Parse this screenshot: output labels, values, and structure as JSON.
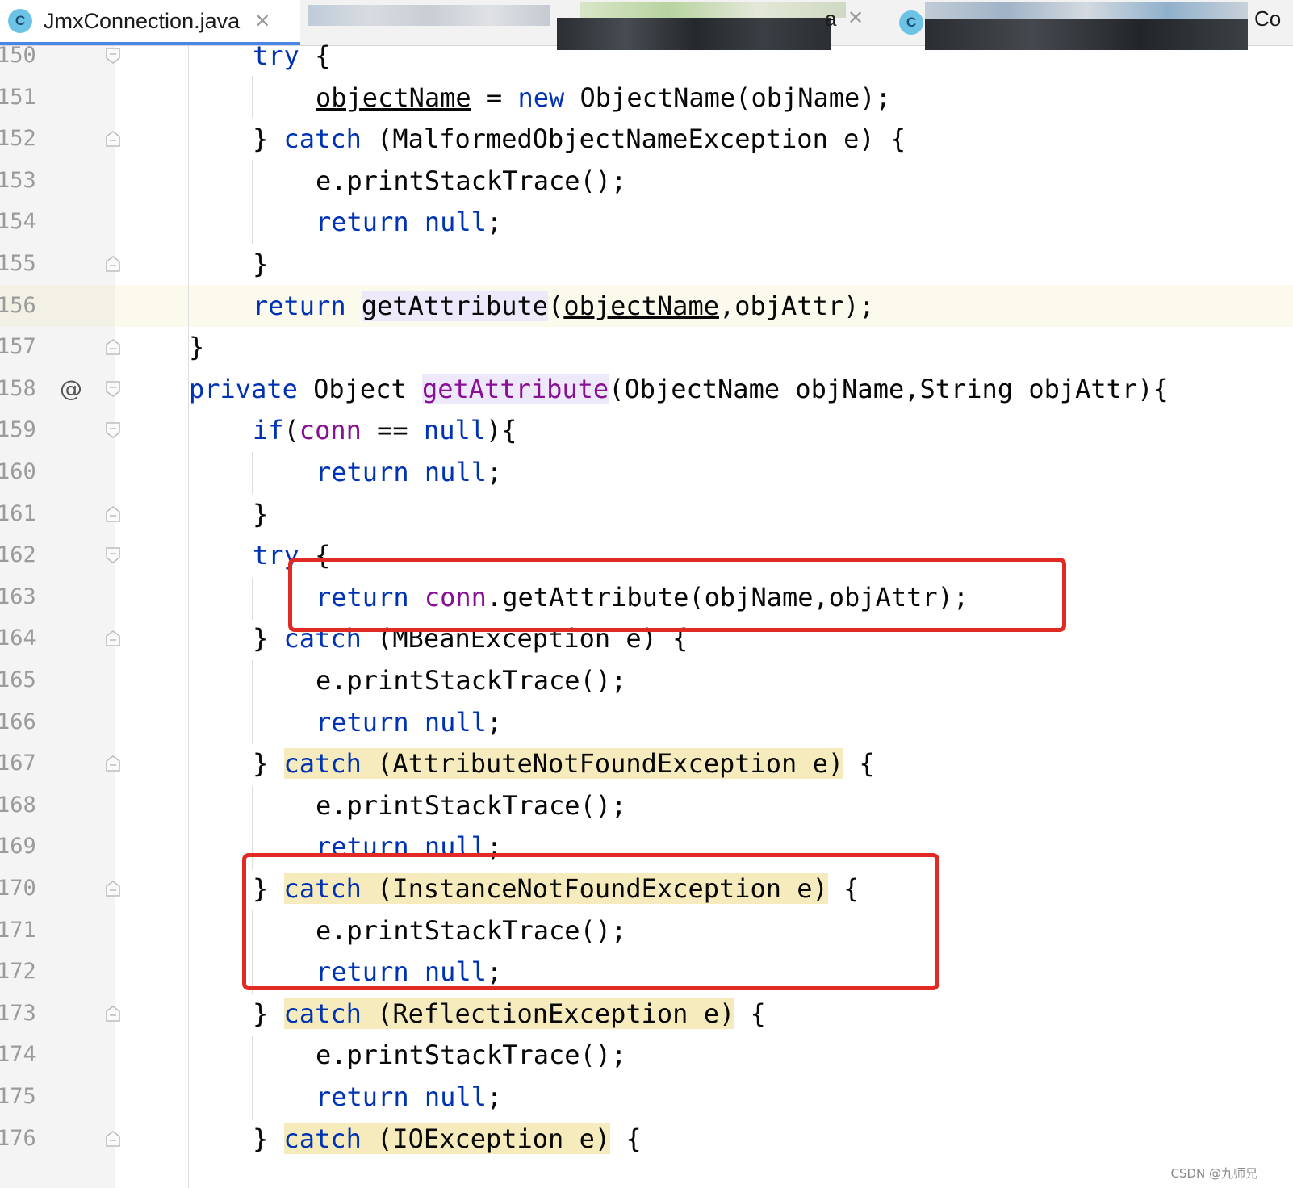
{
  "tabs": [
    {
      "label": "JmxConnection.java",
      "badge": "C",
      "close": "✕",
      "active": true
    },
    {
      "label": "a",
      "close": "✕",
      "active": false
    },
    {
      "badge": "C",
      "label": "Co",
      "active": false
    }
  ],
  "editor": {
    "current_line": 156,
    "lines": [
      {
        "n": "150",
        "fold": "open",
        "parts": [
          {
            "t": "try",
            "c": "kw"
          },
          {
            "t": " {"
          }
        ]
      },
      {
        "n": "151",
        "fold": "none",
        "parts": [
          {
            "t": "objectName",
            "c": "ul"
          },
          {
            "t": " = "
          },
          {
            "t": "new",
            "c": "kw"
          },
          {
            "t": " ObjectName(objName);"
          }
        ]
      },
      {
        "n": "152",
        "fold": "close",
        "parts": [
          {
            "t": "} "
          },
          {
            "t": "catch",
            "c": "kw"
          },
          {
            "t": " (MalformedObjectNameException e) {"
          }
        ]
      },
      {
        "n": "153",
        "fold": "none",
        "parts": [
          {
            "t": "e.printStackTrace();"
          }
        ]
      },
      {
        "n": "154",
        "fold": "none",
        "parts": [
          {
            "t": "return",
            "c": "kw"
          },
          {
            "t": " "
          },
          {
            "t": "null",
            "c": "kw"
          },
          {
            "t": ";"
          }
        ]
      },
      {
        "n": "155",
        "fold": "close",
        "parts": [
          {
            "t": "}"
          }
        ]
      },
      {
        "n": "156",
        "fold": "none",
        "parts": [
          {
            "t": "return",
            "c": "kw"
          },
          {
            "t": " "
          },
          {
            "t": "getAttribute",
            "c": "hl-usage"
          },
          {
            "t": "("
          },
          {
            "t": "objectName",
            "c": "ul"
          },
          {
            "t": ",objAttr);"
          }
        ]
      },
      {
        "n": "157",
        "fold": "close",
        "parts": [
          {
            "t": "}"
          }
        ]
      },
      {
        "n": "158",
        "fold": "open",
        "marker": "@",
        "parts": [
          {
            "t": "private",
            "c": "kw"
          },
          {
            "t": " Object "
          },
          {
            "t": "getAttribute",
            "c": "hl-usage fld"
          },
          {
            "t": "(ObjectName objName,String objAttr){"
          }
        ]
      },
      {
        "n": "159",
        "fold": "open",
        "parts": [
          {
            "t": "if",
            "c": "kw"
          },
          {
            "t": "("
          },
          {
            "t": "conn",
            "c": "fld"
          },
          {
            "t": " == "
          },
          {
            "t": "null",
            "c": "kw"
          },
          {
            "t": "){"
          }
        ]
      },
      {
        "n": "160",
        "fold": "none",
        "parts": [
          {
            "t": "return",
            "c": "kw"
          },
          {
            "t": " "
          },
          {
            "t": "null",
            "c": "kw"
          },
          {
            "t": ";"
          }
        ]
      },
      {
        "n": "161",
        "fold": "close",
        "parts": [
          {
            "t": "}"
          }
        ]
      },
      {
        "n": "162",
        "fold": "open",
        "parts": [
          {
            "t": "try",
            "c": "kw"
          },
          {
            "t": " {"
          }
        ]
      },
      {
        "n": "163",
        "fold": "none",
        "parts": [
          {
            "t": "return",
            "c": "kw"
          },
          {
            "t": " "
          },
          {
            "t": "conn",
            "c": "fld"
          },
          {
            "t": ".getAttribute(objName,objAttr);"
          }
        ]
      },
      {
        "n": "164",
        "fold": "close",
        "parts": [
          {
            "t": "} "
          },
          {
            "t": "catch",
            "c": "kw"
          },
          {
            "t": " (MBeanException e) {"
          }
        ]
      },
      {
        "n": "165",
        "fold": "none",
        "parts": [
          {
            "t": "e.printStackTrace();"
          }
        ]
      },
      {
        "n": "166",
        "fold": "none",
        "parts": [
          {
            "t": "return",
            "c": "kw"
          },
          {
            "t": " "
          },
          {
            "t": "null",
            "c": "kw"
          },
          {
            "t": ";"
          }
        ]
      },
      {
        "n": "167",
        "fold": "close",
        "parts": [
          {
            "t": "} "
          },
          {
            "t": "catch",
            "c": "kw hl-catch"
          },
          {
            "t": " (AttributeNotFoundException e)",
            "c": "hl-catch"
          },
          {
            "t": " {"
          }
        ]
      },
      {
        "n": "168",
        "fold": "none",
        "parts": [
          {
            "t": "e.printStackTrace();"
          }
        ]
      },
      {
        "n": "169",
        "fold": "none",
        "parts": [
          {
            "t": "return",
            "c": "kw"
          },
          {
            "t": " "
          },
          {
            "t": "null",
            "c": "kw"
          },
          {
            "t": ";"
          }
        ]
      },
      {
        "n": "170",
        "fold": "close",
        "parts": [
          {
            "t": "} "
          },
          {
            "t": "catch",
            "c": "kw hl-catch"
          },
          {
            "t": " (InstanceNotFoundException e)",
            "c": "hl-catch"
          },
          {
            "t": " {"
          }
        ]
      },
      {
        "n": "171",
        "fold": "none",
        "parts": [
          {
            "t": "e.printStackTrace();"
          }
        ]
      },
      {
        "n": "172",
        "fold": "none",
        "parts": [
          {
            "t": "return",
            "c": "kw"
          },
          {
            "t": " "
          },
          {
            "t": "null",
            "c": "kw"
          },
          {
            "t": ";"
          }
        ]
      },
      {
        "n": "173",
        "fold": "close",
        "parts": [
          {
            "t": "} "
          },
          {
            "t": "catch",
            "c": "kw hl-catch"
          },
          {
            "t": " (ReflectionException e)",
            "c": "hl-catch"
          },
          {
            "t": " {"
          }
        ]
      },
      {
        "n": "174",
        "fold": "none",
        "parts": [
          {
            "t": "e.printStackTrace();"
          }
        ]
      },
      {
        "n": "175",
        "fold": "none",
        "parts": [
          {
            "t": "return",
            "c": "kw"
          },
          {
            "t": " "
          },
          {
            "t": "null",
            "c": "kw"
          },
          {
            "t": ";"
          }
        ]
      },
      {
        "n": "176",
        "fold": "close",
        "parts": [
          {
            "t": "} "
          },
          {
            "t": "catch",
            "c": "kw hl-catch"
          },
          {
            "t": " (IOException e)",
            "c": "hl-catch"
          },
          {
            "t": " {"
          }
        ]
      }
    ]
  },
  "colors": {
    "keyword": "#0033b3",
    "field": "#871094",
    "annotation_box": "#e12a24",
    "catch_highlight": "#f6ebbc",
    "usage_highlight": "#ede9fb"
  },
  "watermark": "CSDN @九师兄"
}
